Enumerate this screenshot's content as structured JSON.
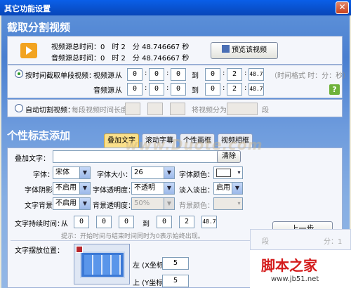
{
  "window": {
    "title": "其它功能设置",
    "close_glyph": "✕"
  },
  "section1": {
    "title": "截取分割视频",
    "info": {
      "video_label": "视频源总时间：0　时 2　分 48.746667 秒",
      "audio_label": "音频源总时间：0　时 2　分 48.746667 秒"
    },
    "preview_button": "预览该视频",
    "mode1": {
      "radio_label": "按时间截取单段视频：",
      "video_source": "视频源",
      "audio_source": "音频源",
      "from": "从",
      "to": "到",
      "video_from": [
        "0",
        "0",
        "0"
      ],
      "video_to": [
        "0",
        "2",
        "48.7"
      ],
      "audio_from": [
        "0",
        "0",
        "0"
      ],
      "audio_to": [
        "0",
        "2",
        "48.7"
      ],
      "format_hint": "（时间格式 时：分：秒）",
      "help": "?"
    },
    "mode2": {
      "radio_label": "自动切割视频：",
      "per_segment_label": "每段视频时间长度",
      "split_label": "将视频分为",
      "unit": "段"
    }
  },
  "section2": {
    "title": "个性标志添加",
    "tabs": [
      "叠加文字",
      "滚动字幕",
      "个性画框",
      "视频相框"
    ],
    "overlay_text": {
      "label": "叠加文字：",
      "value": "",
      "clear_button": "清除"
    },
    "font_label": "字体：",
    "font_value": "宋体",
    "size_label": "字体大小：",
    "size_value": "26",
    "color_label": "字体颜色：",
    "shadow_label": "字体阴影：",
    "shadow_value": "不启用",
    "transparency_label": "字体透明度：",
    "transparency_value": "不透明",
    "fade_label": "淡入淡出：",
    "fade_value": "启用",
    "bg_label": "文字背景：",
    "bg_value": "不启用",
    "bg_transparency_label": "背景透明度：",
    "bg_transparency_value": "50%",
    "bg_color_label": "背景颜色：",
    "duration_label": "文字持续时间：",
    "from": "从",
    "to": "到",
    "dur_from": [
      "0",
      "0",
      "0"
    ],
    "dur_to": [
      "0",
      "2",
      "48.7"
    ],
    "duration_hint": "提示：开始时间与结束时间同时为0表示始终出现。",
    "position_label": "文字摆放位置：",
    "left_label": "左 (X坐标)",
    "left_value": "5",
    "top_label": "上 (Y坐标)",
    "top_value": "5",
    "prev_button": "上一步",
    "side_fragment": "段",
    "side_fragment2": "分：1"
  },
  "watermark": "www.Duote.com",
  "brand": {
    "name": "脚本之家",
    "url": "www.jb51.net"
  },
  "colors": {
    "accent": "#0a5fe8",
    "tab_active": "#fbe08a",
    "brand": "#d41b1b"
  }
}
